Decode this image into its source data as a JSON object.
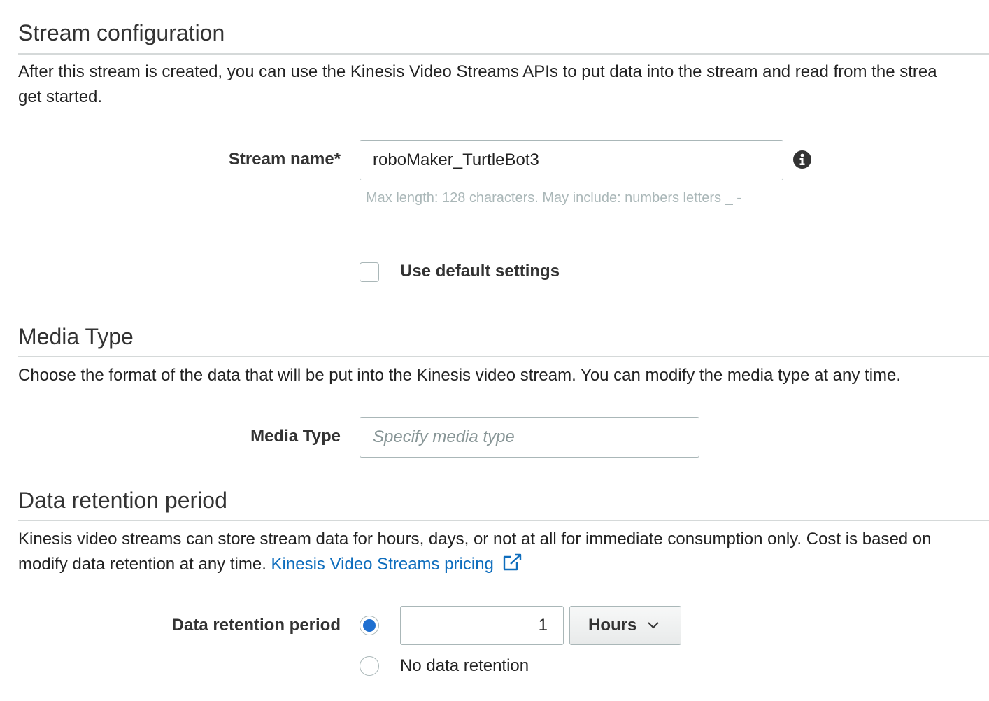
{
  "stream_config": {
    "title": "Stream configuration",
    "description_line1": "After this stream is created, you can use the Kinesis Video Streams APIs to put data into the stream and read from the strea",
    "description_line2": "get started.",
    "stream_name_label": "Stream name*",
    "stream_name_value": "roboMaker_TurtleBot3",
    "stream_name_hint": "Max length: 128 characters. May include: numbers letters _ -",
    "default_settings_label": "Use default settings",
    "default_settings_checked": false
  },
  "media_type": {
    "title": "Media Type",
    "description": "Choose the format of the data that will be put into the Kinesis video stream. You can modify the media type at any time.",
    "label": "Media Type",
    "placeholder": "Specify media type",
    "value": ""
  },
  "data_retention": {
    "title": "Data retention period",
    "description_line1": "Kinesis video streams can store stream data for hours, days, or not at all for immediate consumption only. Cost is based on",
    "description_line2": "modify data retention at any time.",
    "pricing_link": "Kinesis Video Streams pricing",
    "label": "Data retention period",
    "period_value": "1",
    "unit_selected": "Hours",
    "no_retention_label": "No data retention",
    "selected_option": "period"
  },
  "icons": {
    "info": "info-icon",
    "external_link": "external-link-icon",
    "chevron": "chevron-down-icon"
  },
  "colors": {
    "link": "#0e6dbd",
    "radio_selected": "#1e6fd0",
    "hint": "#aab7b8",
    "rule": "#d5d9d9"
  }
}
